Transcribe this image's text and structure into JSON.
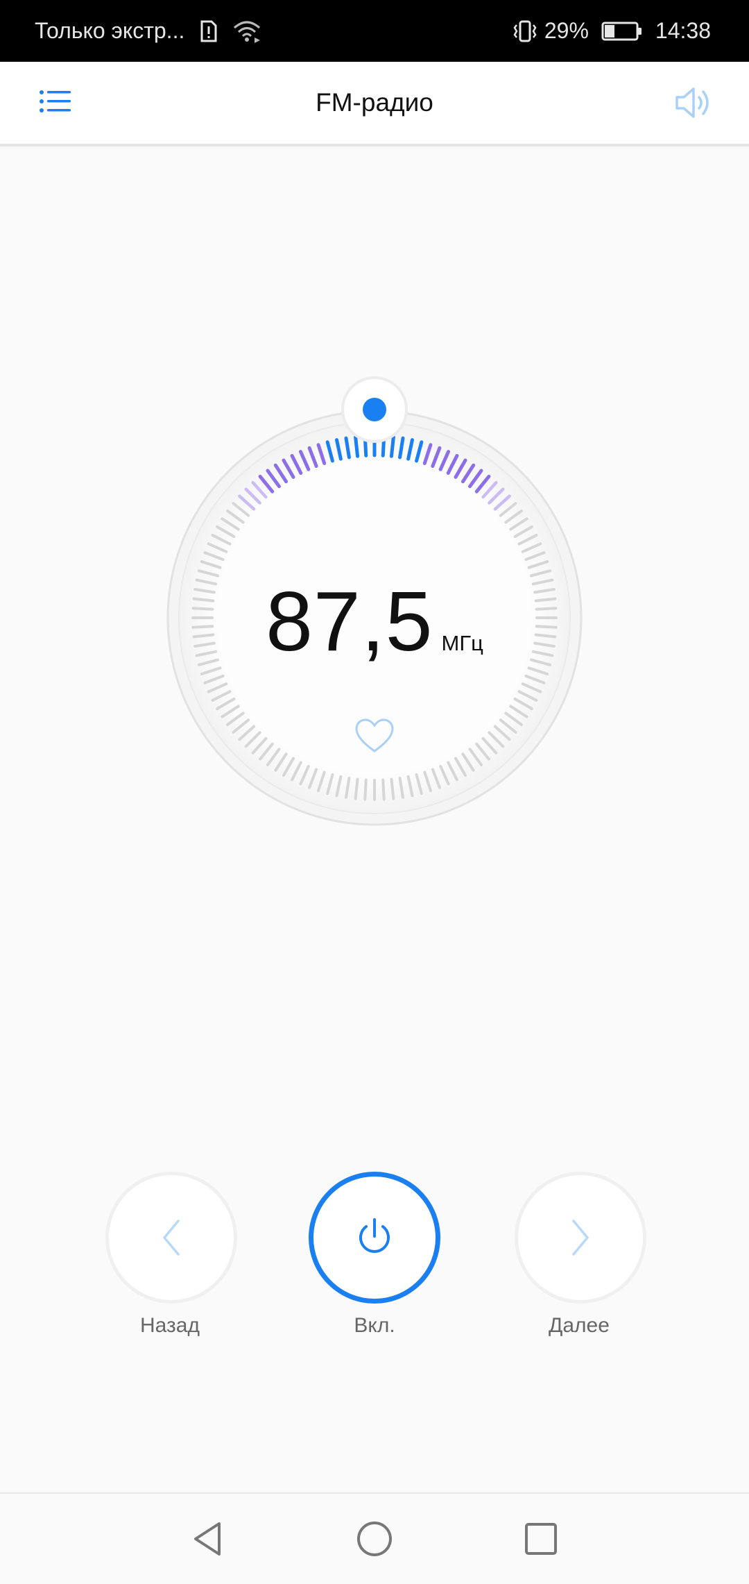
{
  "status_bar": {
    "carrier": "Только экстр...",
    "battery": "29%",
    "time": "14:38",
    "icons": [
      "sim-alert-icon",
      "wifi-icon",
      "vibrate-icon",
      "battery-icon"
    ]
  },
  "app_bar": {
    "title": "FM-радио",
    "menu_icon": "list-icon",
    "speaker_icon": "speaker-icon"
  },
  "tuner": {
    "frequency": "87,5",
    "unit": "МГц",
    "favorite_icon": "heart-icon"
  },
  "controls": {
    "prev_label": "Назад",
    "power_label": "Вкл.",
    "next_label": "Далее"
  },
  "colors": {
    "accent": "#1a7ff0",
    "tick_purple": "#8b6ee8",
    "tick_gray": "#d6d6d6"
  }
}
